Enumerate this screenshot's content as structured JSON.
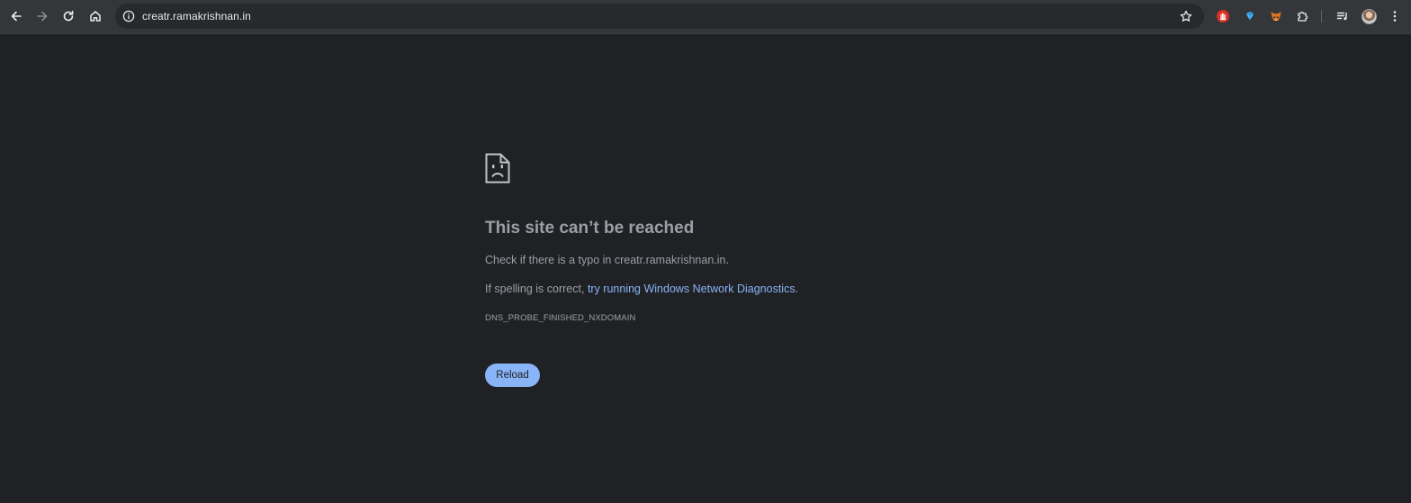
{
  "browser": {
    "url": "creatr.ramakrishnan.in",
    "icons": {
      "back": "arrow-left-icon",
      "forward": "arrow-right-icon",
      "reload": "reload-icon",
      "home": "home-icon",
      "site_info": "info-icon",
      "bookmark": "star-icon",
      "extensions": [
        "hand-stop-extension-icon",
        "diamond-extension-icon",
        "fox-extension-icon",
        "puzzle-icon"
      ],
      "reading_list": "reading-list-icon",
      "profile": "avatar",
      "menu": "kebab-menu-icon"
    }
  },
  "error_page": {
    "icon": "sad-document-icon",
    "title": "This site can’t be reached",
    "line1_prefix": "Check if there is a typo in ",
    "line1_host": "creatr.ramakrishnan.in",
    "line1_suffix": ".",
    "line2_prefix": "If spelling is correct, ",
    "line2_link": "try running Windows Network Diagnostics",
    "line2_suffix": ".",
    "error_code": "DNS_PROBE_FINISHED_NXDOMAIN",
    "reload_label": "Reload"
  },
  "colors": {
    "background": "#202124",
    "toolbar": "#35363a",
    "text_muted": "#9aa0a6",
    "link": "#8ab4f8",
    "button": "#8ab4f8"
  }
}
